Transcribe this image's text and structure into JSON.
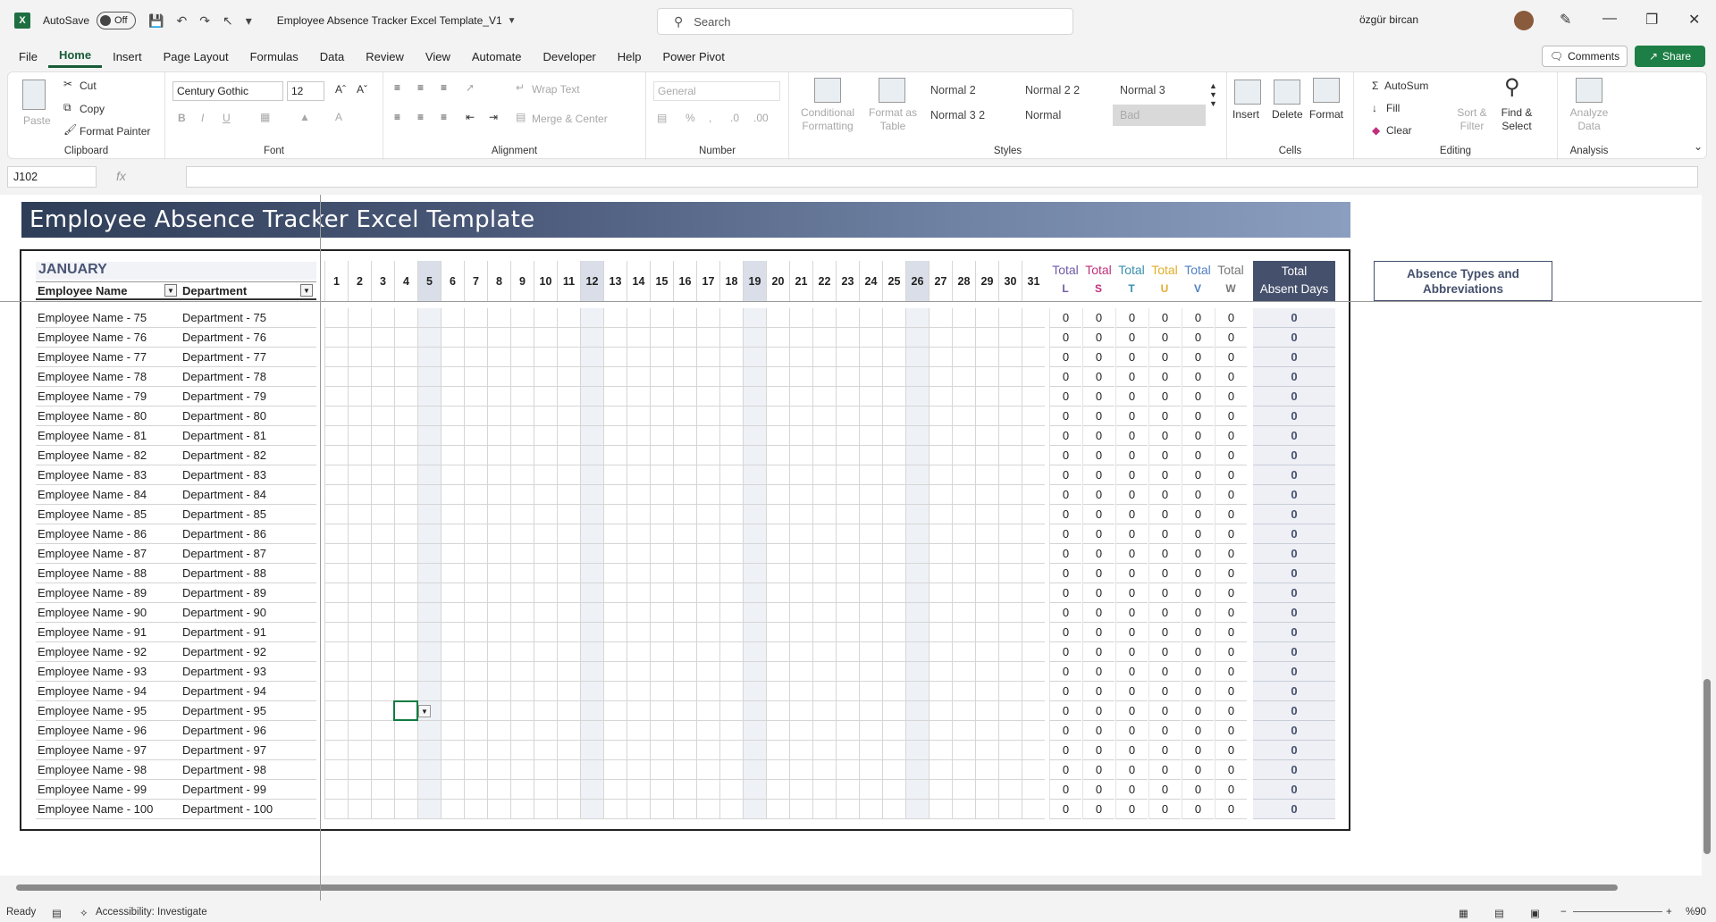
{
  "titlebar": {
    "autosave_label": "AutoSave",
    "autosave_state": "Off",
    "document_title": "Employee Absence Tracker Excel Template_V1",
    "search_placeholder": "Search",
    "user_name": "özgür bircan"
  },
  "menu": {
    "tabs": [
      "File",
      "Home",
      "Insert",
      "Page Layout",
      "Formulas",
      "Data",
      "Review",
      "View",
      "Automate",
      "Developer",
      "Help",
      "Power Pivot"
    ],
    "active": "Home",
    "comments_label": "Comments",
    "share_label": "Share"
  },
  "ribbon": {
    "clipboard": {
      "label": "Clipboard",
      "paste": "Paste",
      "cut": "Cut",
      "copy": "Copy",
      "format_painter": "Format Painter"
    },
    "font": {
      "label": "Font",
      "family": "Century Gothic",
      "size": "12"
    },
    "alignment": {
      "label": "Alignment",
      "wrap_text": "Wrap Text",
      "merge_center": "Merge & Center"
    },
    "number": {
      "label": "Number",
      "format": "General"
    },
    "styles": {
      "label": "Styles",
      "conditional_formatting": "Conditional Formatting",
      "format_as_table": "Format as Table",
      "gallery": [
        "Normal 2",
        "Normal 2 2",
        "Normal 3",
        "Normal 3 2",
        "Normal",
        "Bad"
      ]
    },
    "cells": {
      "label": "Cells",
      "insert": "Insert",
      "delete": "Delete",
      "format": "Format"
    },
    "editing": {
      "label": "Editing",
      "autosum": "AutoSum",
      "fill": "Fill",
      "clear": "Clear",
      "sort_filter": "Sort & Filter",
      "find_select": "Find & Select"
    },
    "analysis": {
      "label": "Analysis",
      "analyze_data": "Analyze Data"
    }
  },
  "formula_bar": {
    "name_box": "J102",
    "fx": "fx",
    "value": ""
  },
  "sheet": {
    "banner_title": "Employee Absence Tracker Excel Template",
    "month": "JANUARY",
    "col_employee": "Employee Name",
    "col_department": "Department",
    "days": [
      "1",
      "2",
      "3",
      "4",
      "5",
      "6",
      "7",
      "8",
      "9",
      "10",
      "11",
      "12",
      "13",
      "14",
      "15",
      "16",
      "17",
      "18",
      "19",
      "20",
      "21",
      "22",
      "23",
      "24",
      "25",
      "26",
      "27",
      "28",
      "29",
      "30",
      "31"
    ],
    "weekend_days": [
      4,
      11,
      18,
      25
    ],
    "totals": [
      {
        "top": "Total",
        "abbr": "L",
        "color": "#6f5aa8"
      },
      {
        "top": "Total",
        "abbr": "S",
        "color": "#c0307a"
      },
      {
        "top": "Total",
        "abbr": "T",
        "color": "#3a8fb0"
      },
      {
        "top": "Total",
        "abbr": "U",
        "color": "#e2ad2a"
      },
      {
        "top": "Total",
        "abbr": "V",
        "color": "#4f7fc2"
      },
      {
        "top": "Total",
        "abbr": "W",
        "color": "#777777"
      }
    ],
    "absent_head_line1": "Total",
    "absent_head_line2": "Absent Days",
    "legend_title_line1": "Absence Types and",
    "legend_title_line2": "Abbreviations",
    "rows": [
      {
        "employee": "Employee Name - 75",
        "department": "Department - 75"
      },
      {
        "employee": "Employee Name - 76",
        "department": "Department - 76"
      },
      {
        "employee": "Employee Name - 77",
        "department": "Department - 77"
      },
      {
        "employee": "Employee Name - 78",
        "department": "Department - 78"
      },
      {
        "employee": "Employee Name - 79",
        "department": "Department - 79"
      },
      {
        "employee": "Employee Name - 80",
        "department": "Department - 80"
      },
      {
        "employee": "Employee Name - 81",
        "department": "Department - 81"
      },
      {
        "employee": "Employee Name - 82",
        "department": "Department - 82"
      },
      {
        "employee": "Employee Name - 83",
        "department": "Department - 83"
      },
      {
        "employee": "Employee Name - 84",
        "department": "Department - 84"
      },
      {
        "employee": "Employee Name - 85",
        "department": "Department - 85"
      },
      {
        "employee": "Employee Name - 86",
        "department": "Department - 86"
      },
      {
        "employee": "Employee Name - 87",
        "department": "Department - 87"
      },
      {
        "employee": "Employee Name - 88",
        "department": "Department - 88"
      },
      {
        "employee": "Employee Name - 89",
        "department": "Department - 89"
      },
      {
        "employee": "Employee Name - 90",
        "department": "Department - 90"
      },
      {
        "employee": "Employee Name - 91",
        "department": "Department - 91"
      },
      {
        "employee": "Employee Name - 92",
        "department": "Department - 92"
      },
      {
        "employee": "Employee Name - 93",
        "department": "Department - 93"
      },
      {
        "employee": "Employee Name - 94",
        "department": "Department - 94"
      },
      {
        "employee": "Employee Name - 95",
        "department": "Department - 95"
      },
      {
        "employee": "Employee Name - 96",
        "department": "Department - 96"
      },
      {
        "employee": "Employee Name - 97",
        "department": "Department - 97"
      },
      {
        "employee": "Employee Name - 98",
        "department": "Department - 98"
      },
      {
        "employee": "Employee Name - 99",
        "department": "Department - 99"
      },
      {
        "employee": "Employee Name - 100",
        "department": "Department - 100"
      }
    ],
    "total_value": "0"
  },
  "status": {
    "ready": "Ready",
    "accessibility": "Accessibility: Investigate",
    "zoom": "%90"
  }
}
